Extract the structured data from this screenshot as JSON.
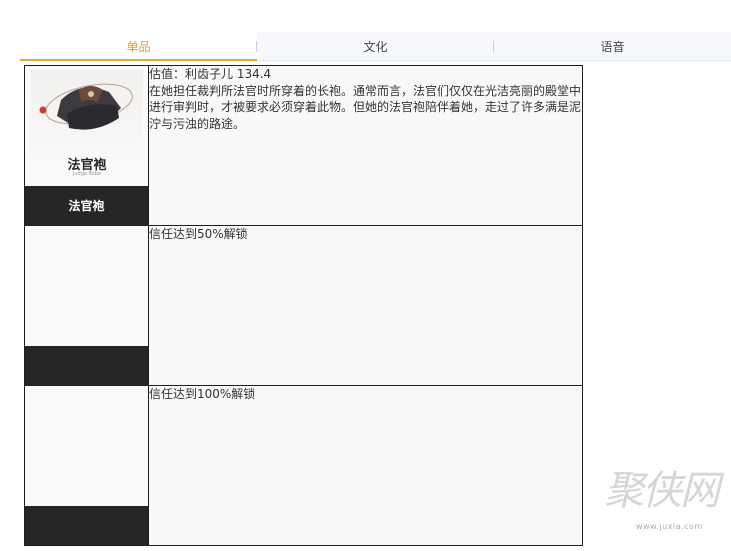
{
  "tabs": [
    {
      "label": "单品",
      "active": true
    },
    {
      "label": "文化",
      "active": false
    },
    {
      "label": "语音",
      "active": false
    }
  ],
  "items": [
    {
      "name": "法官袍",
      "card_title": "法官袍",
      "card_subtitle": "Judge Robe",
      "value_line": "估值：利齿子儿 134.4",
      "description": "在她担任裁判所法官时所穿着的长袍。通常而言，法官们仅仅在光洁亮丽的殿堂中进行审判时，才被要求必须穿着此物。但她的法官袍陪伴着她，走过了许多满是泥泞与污浊的路途。"
    },
    {
      "name": "",
      "unlock_text": "信任达到50%解锁"
    },
    {
      "name": "",
      "unlock_text": "信任达到100%解锁"
    }
  ],
  "watermark": {
    "text": "聚侠网",
    "url": "www.juxia.com"
  },
  "colors": {
    "accent": "#e3a93b",
    "dark_bar": "#262626",
    "cell_bg": "#f9f8f8"
  }
}
